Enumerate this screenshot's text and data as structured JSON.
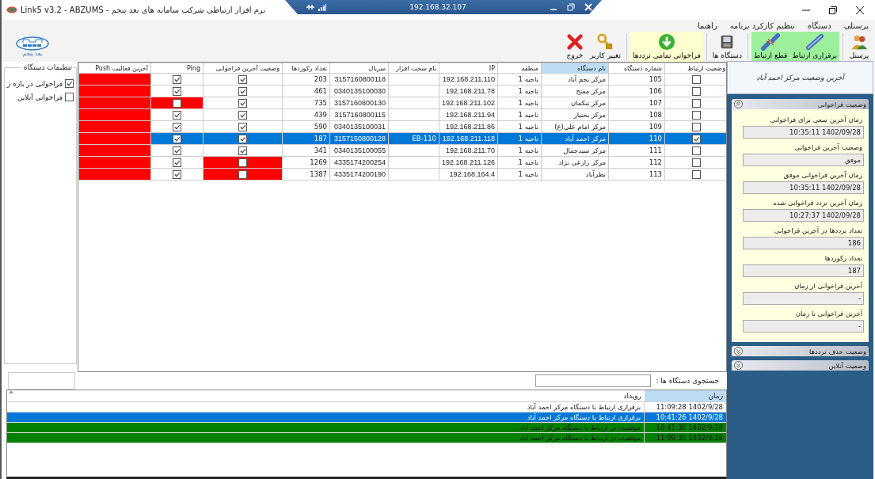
{
  "window": {
    "title": "Link5 v3.2 - ABZUMS - نرم افزار ارتباطی شرکت سامانه های بعد پنجم",
    "remote_host": "192.168.32.107"
  },
  "menu": [
    "پرسنلی",
    "دستگاه",
    "تنظیم کارکرد برنامه",
    "راهنما"
  ],
  "toolbar": [
    {
      "kind": "personnel",
      "label": "پرسنل"
    },
    {
      "kind": "connect",
      "label": "برقراری ارتباط",
      "color": "#9cf09c"
    },
    {
      "kind": "disconnect",
      "label": "قطع ارتباط",
      "color": "#9cf09c"
    },
    {
      "kind": "devices",
      "label": "دستگاه ها"
    },
    {
      "kind": "fetch",
      "label": "فراخوانی تمامی ترددها",
      "color": "#ffffd0"
    },
    {
      "kind": "user",
      "label": "تغییر کاربر"
    },
    {
      "kind": "exit",
      "label": "خروج"
    }
  ],
  "logo": {
    "caption": "بعد پنجم"
  },
  "device_settings": {
    "title": "تنظیمات دستگاه",
    "options": [
      {
        "label": "فراخوانی در بازه ز",
        "checked": true
      },
      {
        "label": "فراخوانی آنلاین",
        "checked": false
      }
    ]
  },
  "devices": {
    "columns": [
      {
        "label": "وضعیت ارتباط",
        "selected": false
      },
      {
        "label": "شماره دستگاه",
        "selected": false
      },
      {
        "label": "نام دستگاه",
        "selected": true
      },
      {
        "label": "منطقه",
        "selected": false
      },
      {
        "label": "IP",
        "selected": false
      },
      {
        "label": "نام سخت افزار",
        "selected": false
      },
      {
        "label": "سریال",
        "selected": false
      },
      {
        "label": "تعداد رکوردها",
        "selected": false
      },
      {
        "label": "وضعیت آخرین فراخوانی",
        "selected": false
      },
      {
        "label": "Ping",
        "selected": false
      },
      {
        "label": "آخرین فعالیت Push",
        "selected": false
      }
    ],
    "rows": [
      {
        "connected": false,
        "number": "105",
        "name": "مرکز نجم آباد",
        "region": "ناحیه 1",
        "ip": "192.168.211.110",
        "serial": "3157160800118",
        "records": "203",
        "last_poll_ok": true,
        "ping": true,
        "push_active": false,
        "selected": false
      },
      {
        "connected": false,
        "number": "106",
        "name": "مرکز مفتح",
        "region": "ناحیه 1",
        "ip": "192.168.211.78",
        "serial": "0340135100030",
        "records": "461",
        "last_poll_ok": true,
        "ping": true,
        "push_active": false,
        "selected": false
      },
      {
        "connected": false,
        "number": "107",
        "name": "مرکز تنکمان",
        "region": "ناحیه 1",
        "ip": "192.168.211.102",
        "serial": "3157160800130",
        "records": "735",
        "last_poll_ok": true,
        "ping": false,
        "push_active": false,
        "selected": false
      },
      {
        "connected": false,
        "number": "108",
        "name": "مرکز بختیار",
        "region": "ناحیه 1",
        "ip": "192.168.211.94",
        "serial": "3157160800115",
        "records": "439",
        "last_poll_ok": true,
        "ping": true,
        "push_active": false,
        "selected": false
      },
      {
        "connected": false,
        "number": "109",
        "name": "مرکز امام علی(ع)",
        "region": "ناحیه 1",
        "ip": "192.168.211.86",
        "serial": "0340135100031",
        "records": "590",
        "last_poll_ok": true,
        "ping": true,
        "push_active": false,
        "selected": false
      },
      {
        "connected": true,
        "number": "110",
        "name": "مرکز احمد آباد",
        "region": "ناحیه 1",
        "ip": "192.168.211.118",
        "hardware": "EB-110",
        "serial": "3157150800128",
        "records": "187",
        "last_poll_ok": true,
        "ping": true,
        "push_active": false,
        "selected": true
      },
      {
        "connected": false,
        "number": "111",
        "name": "مرکز سیدجمال",
        "region": "ناحیه 1",
        "ip": "192.168.211.70",
        "serial": "0340135100055",
        "records": "341",
        "last_poll_ok": true,
        "ping": true,
        "push_active": false,
        "selected": false
      },
      {
        "connected": false,
        "number": "112",
        "name": "مرکز زارعی نژاد",
        "region": "ناحیه 1",
        "ip": "192.168.211.126",
        "serial": "4335174200254",
        "records": "1269",
        "last_poll_ok": false,
        "ping": true,
        "push_active": false,
        "selected": false
      },
      {
        "connected": false,
        "number": "113",
        "name": "نظرآباد",
        "region": "ناحیه 1",
        "ip": "192.168.164.4",
        "serial": "4335174200190",
        "records": "1387",
        "last_poll_ok": false,
        "ping": true,
        "push_active": false,
        "selected": false
      }
    ]
  },
  "search": {
    "label": "جستجوی دستگاه ها :"
  },
  "events": {
    "columns": [
      {
        "label": "زمان",
        "selected": true
      },
      {
        "label": "رویداد",
        "selected": false
      }
    ],
    "rows": [
      {
        "time": "1402/9/28 11:09:28",
        "text": "برقراری ارتباط با دستگاه مرکز احمد آباد",
        "kind": "info",
        "selected": false
      },
      {
        "time": "1402/9/28 10:41:26",
        "text": "برقراری ارتباط با دستگاه مرکز احمد آباد",
        "kind": "info",
        "selected": true
      },
      {
        "time": "1402/9/28 10:41:30",
        "text": "موفقیت در ارتباط با دستگاه مرکز احمد آباد",
        "kind": "success",
        "selected": false
      },
      {
        "time": "1402/9/28 11:09:30",
        "text": "موفقیت در ارتباط با دستگاه مرکز احمد آباد",
        "kind": "success",
        "selected": false
      }
    ]
  },
  "status_panel": {
    "title": "آخرین وضعیت مرکز احمد آباد",
    "sections": [
      {
        "title": "وضعیت فراخوانی",
        "expanded": true,
        "fields": [
          {
            "label": "زمان آخرین سعی برای فراخوانی",
            "value": "1402/09/28 10:35:11"
          },
          {
            "label": "وضعیت آخرین فراخوانی",
            "value": "موفق"
          },
          {
            "label": "زمان آخرین فراخوانی موفق",
            "value": "1402/09/28 10:35:11"
          },
          {
            "label": "زمان آخرین تردد فراخوانی شده",
            "value": "1402/09/28 10:27:37"
          },
          {
            "label": "تعداد ترددها در آخرین فراخوانی",
            "value": "186"
          },
          {
            "label": "تعداد رکوردها",
            "value": "187"
          },
          {
            "label": "آخرین فراخوانی از زمان",
            "value": "-"
          },
          {
            "label": "آخرین فراخوانی تا زمان",
            "value": "-"
          }
        ]
      },
      {
        "title": "وضعیت حذف ترددها",
        "expanded": false
      },
      {
        "title": "وضعیت آنلاین",
        "expanded": false
      }
    ]
  }
}
